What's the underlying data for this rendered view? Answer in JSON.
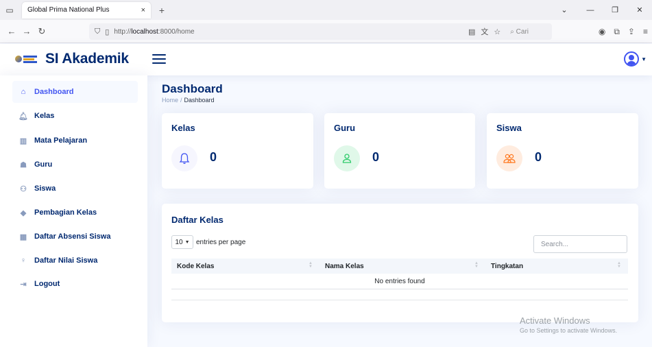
{
  "browser": {
    "tab_title": "Global Prima National Plus",
    "tab_close": "×",
    "new_tab": "+",
    "url_prefix": "http://",
    "url_host": "localhost",
    "url_rest": ":8000/home",
    "search_placeholder": "Cari"
  },
  "header": {
    "brand": "SI Akademik"
  },
  "sidebar": {
    "items": [
      {
        "label": "Dashboard",
        "icon": "home-icon",
        "active": true
      },
      {
        "label": "Kelas",
        "icon": "bell-icon"
      },
      {
        "label": "Mata Pelajaran",
        "icon": "book-icon"
      },
      {
        "label": "Guru",
        "icon": "teacher-icon"
      },
      {
        "label": "Siswa",
        "icon": "students-icon"
      },
      {
        "label": "Pembagian Kelas",
        "icon": "graduation-icon"
      },
      {
        "label": "Daftar Absensi Siswa",
        "icon": "calendar-icon"
      },
      {
        "label": "Daftar Nilai Siswa",
        "icon": "award-icon"
      },
      {
        "label": "Logout",
        "icon": "logout-icon"
      }
    ]
  },
  "main": {
    "title": "Dashboard",
    "breadcrumb": {
      "home": "Home",
      "sep": "/",
      "current": "Dashboard"
    },
    "cards": [
      {
        "title": "Kelas",
        "value": "0",
        "icon": "bell-icon"
      },
      {
        "title": "Guru",
        "value": "0",
        "icon": "user-icon"
      },
      {
        "title": "Siswa",
        "value": "0",
        "icon": "people-icon"
      }
    ],
    "table": {
      "title": "Daftar Kelas",
      "entries_value": "10",
      "entries_label": "entries per page",
      "search_placeholder": "Search...",
      "columns": [
        "Kode Kelas",
        "Nama Kelas",
        "Tingkatan"
      ],
      "empty_text": "No entries found"
    }
  },
  "watermark": {
    "line1": "Activate Windows",
    "line2": "Go to Settings to activate Windows."
  }
}
